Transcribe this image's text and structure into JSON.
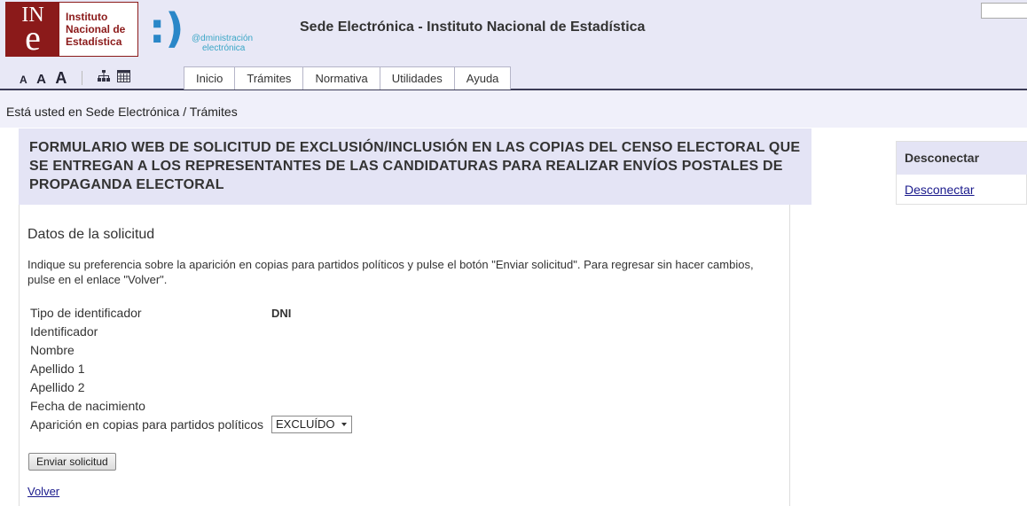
{
  "header": {
    "logo_ine": {
      "mark_top": "IN",
      "mark_bottom": "e",
      "line1": "Instituto",
      "line2": "Nacional de",
      "line3": "Estadística"
    },
    "logo_admin": {
      "mark": ":)",
      "line1": "@dministración",
      "line2": "electrónica"
    },
    "site_title": "Sede Electrónica - Instituto Nacional de Estadística",
    "font_size_controls": [
      "A",
      "A",
      "A"
    ],
    "icons": [
      "sitemap-icon",
      "calendar-icon"
    ]
  },
  "nav": {
    "tabs": [
      "Inicio",
      "Trámites",
      "Normativa",
      "Utilidades",
      "Ayuda"
    ]
  },
  "breadcrumb": "Está usted en Sede Electrónica / Trámites",
  "form": {
    "title": "FORMULARIO WEB DE SOLICITUD DE EXCLUSIÓN/INCLUSIÓN EN LAS COPIAS DEL CENSO ELECTORAL QUE SE ENTREGAN A LOS REPRESENTANTES DE LAS CANDIDATURAS PARA REALIZAR ENVÍOS POSTALES DE PROPAGANDA ELECTORAL",
    "section_title": "Datos de la solicitud",
    "instructions": "Indique su preferencia sobre la aparición en copias para partidos políticos y pulse el botón \"Enviar solicitud\". Para regresar sin hacer cambios, pulse en el enlace \"Volver\".",
    "fields": [
      {
        "label": "Tipo de identificador",
        "value": "DNI"
      },
      {
        "label": "Identificador",
        "value": ""
      },
      {
        "label": "Nombre",
        "value": ""
      },
      {
        "label": "Apellido 1",
        "value": ""
      },
      {
        "label": "Apellido 2",
        "value": ""
      },
      {
        "label": "Fecha de nacimiento",
        "value": ""
      }
    ],
    "select": {
      "label": "Aparición en copias para partidos políticos",
      "value": "EXCLUÍDO"
    },
    "submit_label": "Enviar solicitud",
    "back_label": "Volver"
  },
  "side_panel": {
    "title": "Desconectar",
    "link": "Desconectar"
  }
}
